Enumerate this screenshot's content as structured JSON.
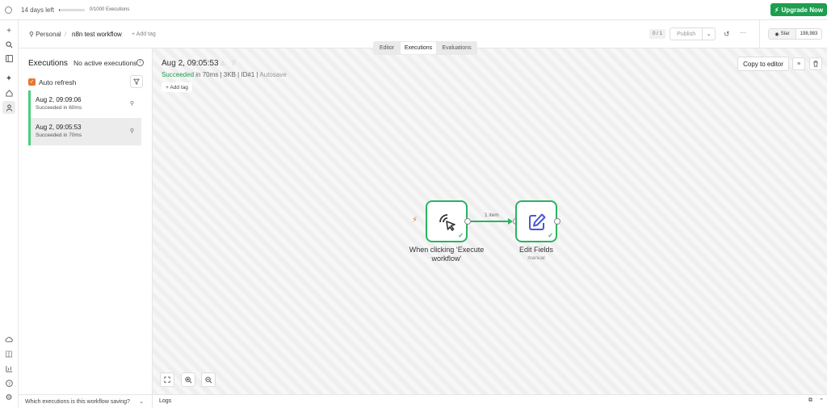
{
  "trial": {
    "days_left": "14 days left",
    "executions": "0/1000 Executions",
    "executions_used_fraction": 0.0
  },
  "upgrade": {
    "label": "Upgrade Now",
    "icon": "lightning-icon"
  },
  "header": {
    "project": "Personal",
    "separator": "/",
    "workflow_name": "n8n test workflow",
    "add_tag": "+ Add tag",
    "version_counter": "0 / 1",
    "publish_label": "Publish",
    "more_label": "···",
    "github_star_label": "Star",
    "github_star_count": "198,983"
  },
  "tabs": [
    {
      "label": "Editor",
      "active": false
    },
    {
      "label": "Executions",
      "active": true
    },
    {
      "label": "Evaluations",
      "active": false
    }
  ],
  "executions_panel": {
    "title": "Executions",
    "no_active": "No active executions",
    "auto_refresh_label": "Auto refresh",
    "auto_refresh_checked": true,
    "items": [
      {
        "date": "Aug 2, 09:09:06",
        "status": "Succeeded in 60ms",
        "selected": false
      },
      {
        "date": "Aug 2, 09:05:53",
        "status": "Succeeded in 70ms",
        "selected": true
      }
    ],
    "question": "Which executions is this workflow saving?"
  },
  "canvas": {
    "execution_date": "Aug 2, 09:05:53",
    "status_word": "Succeeded",
    "status_rest": " in 70ms | 3KB | ID#1 | ",
    "autosave": "Autosave",
    "add_tag": "+ Add tag",
    "copy_to_editor": "Copy to editor",
    "nodes": [
      {
        "label": "When clicking ‘Execute workflow’",
        "icon": "cursor-click-icon",
        "sub": ""
      },
      {
        "label": "Edit Fields",
        "icon": "pencil-edit-icon",
        "sub": "manual"
      }
    ],
    "edge_label": "1 item"
  },
  "logs": {
    "label": "Logs"
  },
  "colors": {
    "accent_green": "#29b463",
    "upgrade_green": "#1e9f4f",
    "orange": "#e8772e"
  }
}
